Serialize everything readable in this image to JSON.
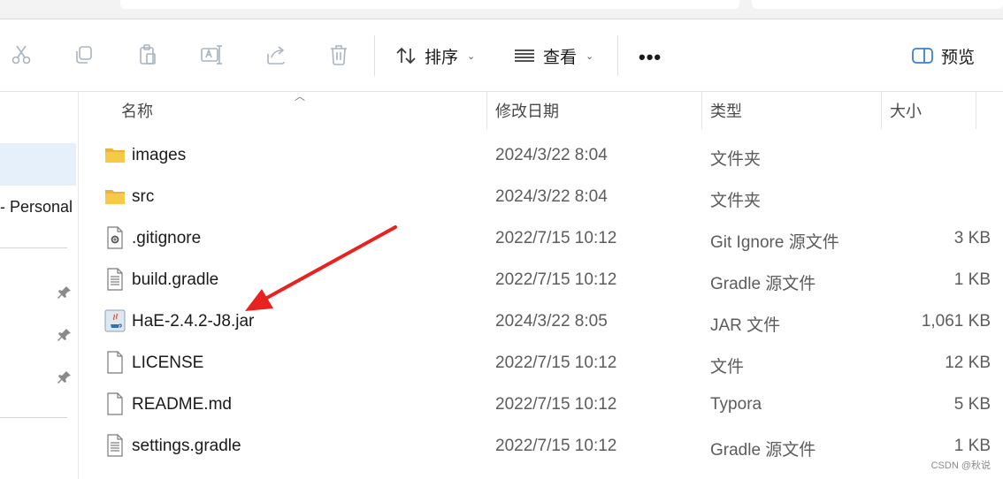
{
  "toolbar": {
    "icons": [
      "cut-icon",
      "copy-icon",
      "paste-icon",
      "rename-icon",
      "share-icon",
      "delete-icon"
    ],
    "sort_label": "排序",
    "view_label": "查看",
    "more_label": "•••",
    "preview_label": "预览"
  },
  "nav": {
    "personal_label": "- Personal"
  },
  "columns": {
    "name": "名称",
    "date": "修改日期",
    "type": "类型",
    "size": "大小"
  },
  "files": [
    {
      "name": "images",
      "date": "2024/3/22 8:04",
      "type": "文件夹",
      "size": "",
      "icon": "folder-icon"
    },
    {
      "name": "src",
      "date": "2024/3/22 8:04",
      "type": "文件夹",
      "size": "",
      "icon": "folder-icon"
    },
    {
      "name": ".gitignore",
      "date": "2022/7/15 10:12",
      "type": "Git Ignore 源文件",
      "size": "3 KB",
      "icon": "config-file-icon"
    },
    {
      "name": "build.gradle",
      "date": "2022/7/15 10:12",
      "type": "Gradle 源文件",
      "size": "1 KB",
      "icon": "text-file-icon"
    },
    {
      "name": "HaE-2.4.2-J8.jar",
      "date": "2024/3/22 8:05",
      "type": "JAR 文件",
      "size": "1,061 KB",
      "icon": "java-jar-icon"
    },
    {
      "name": "LICENSE",
      "date": "2022/7/15 10:12",
      "type": "文件",
      "size": "12 KB",
      "icon": "blank-file-icon"
    },
    {
      "name": "README.md",
      "date": "2022/7/15 10:12",
      "type": "Typora",
      "size": "5 KB",
      "icon": "blank-file-icon"
    },
    {
      "name": "settings.gradle",
      "date": "2022/7/15 10:12",
      "type": "Gradle 源文件",
      "size": "1 KB",
      "icon": "text-file-icon"
    }
  ],
  "watermark": "CSDN @秋说",
  "colors": {
    "arrow": "#e8231f",
    "folder": "#f7c948",
    "selection": "#e6f0fa",
    "preview_accent": "#3b7fd4"
  }
}
